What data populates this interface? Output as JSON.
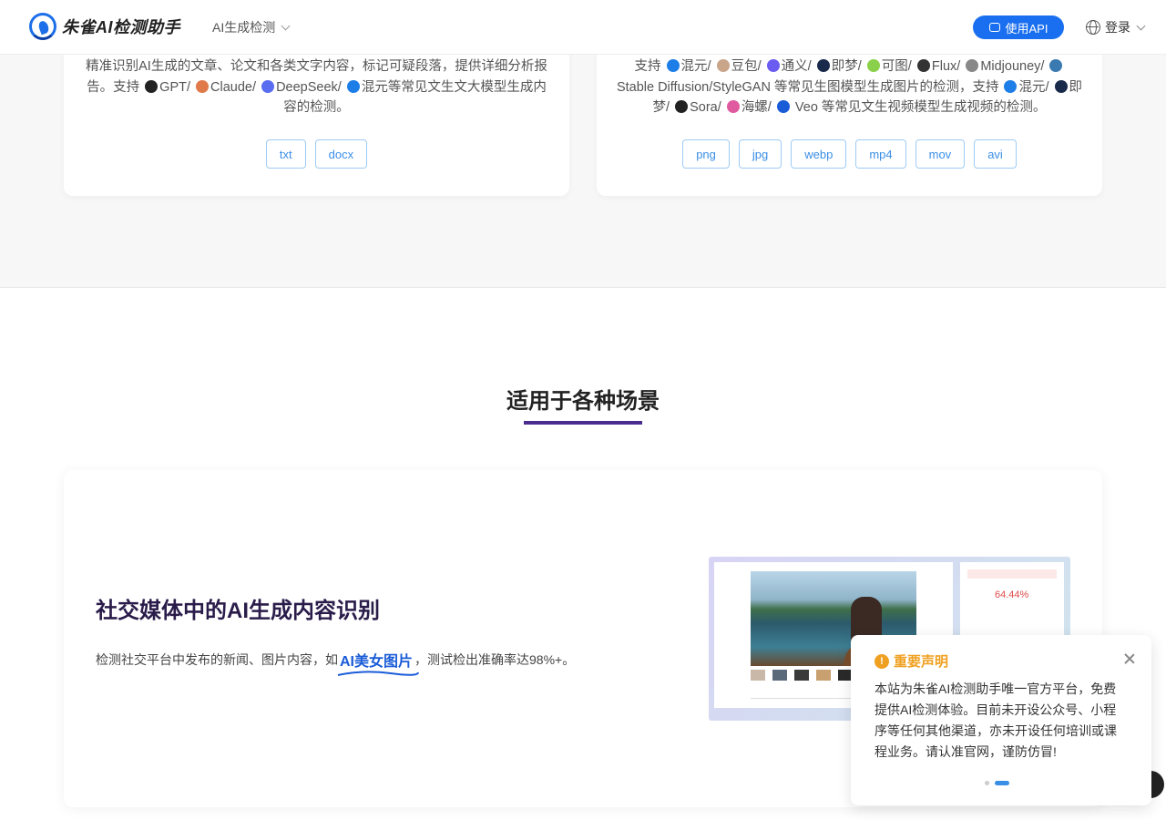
{
  "header": {
    "logo_text": "朱雀AI检测助手",
    "nav_label": "AI生成检测",
    "api_label": "使用API",
    "login_label": "登录"
  },
  "cards": {
    "text": {
      "desc_line": "精准识别AI生成的文章、论文和各类文字内容，标记可疑段落，提供详细分析报告。支持",
      "models": [
        "GPT/",
        "Claude/",
        "DeepSeek/",
        "混元等常见文生文大模型生成内容的检测。"
      ],
      "formats": [
        "txt",
        "docx"
      ]
    },
    "media": {
      "prefix": "支持",
      "image_models": [
        "混元/",
        "豆包/",
        "通义/",
        "即梦/",
        "可图/",
        "Flux/",
        "Midjouney/"
      ],
      "image_suffix": "Stable Diffusion/StyleGAN 等常见生图模型生成图片的检测，支持",
      "video_models": [
        "混元/",
        "即梦/",
        "Sora/",
        "海螺/"
      ],
      "video_suffix": "Veo 等常见文生视频模型生成视频的检测。",
      "formats": [
        "png",
        "jpg",
        "webp",
        "mp4",
        "mov",
        "avi"
      ]
    }
  },
  "section": {
    "title": "适用于各种场景"
  },
  "scenario": {
    "title": "社交媒体中的AI生成内容识别",
    "desc_prefix": "检测社交平台中发布的新闻、图片内容，如",
    "highlight": "AI美女图片",
    "desc_suffix": "，测试检出准确率达98%+。",
    "mock_pct": "64.44%"
  },
  "notice": {
    "title": "重要声明",
    "body": "本站为朱雀AI检测助手唯一官方平台，免费提供AI检测体验。目前未开设公众号、小程序等任何其他渠道，亦未开设任何培训或课程业务。请认准官网，谨防仿冒!"
  },
  "colors": {
    "primary": "#1a6ff0",
    "accent_purple": "#4a2c8f",
    "warning": "#f0a020"
  }
}
